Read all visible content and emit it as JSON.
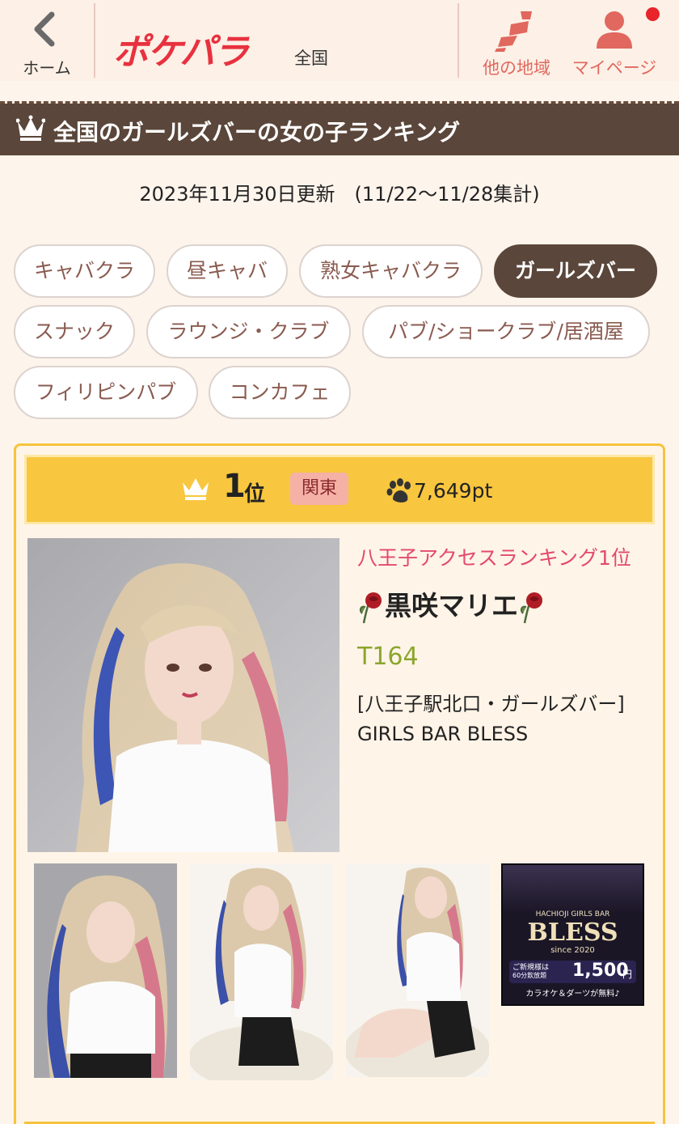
{
  "header": {
    "back_label": "ホーム",
    "logo_text": "ポケパラ",
    "logo_sub": "全国",
    "region_label": "他の地域",
    "mypage_label": "マイページ"
  },
  "title": "全国のガールズバーの女の子ランキング",
  "update_text": "2023年11月30日更新　(11/22〜11/28集計)",
  "categories": [
    {
      "label": "キャバクラ",
      "active": false
    },
    {
      "label": "昼キャバ",
      "active": false
    },
    {
      "label": "熟女キャバクラ",
      "active": false
    },
    {
      "label": "ガールズバー",
      "active": true
    },
    {
      "label": "スナック",
      "active": false
    },
    {
      "label": "ラウンジ・クラブ",
      "active": false
    },
    {
      "label": "パブ/ショークラブ/居酒屋",
      "active": false
    },
    {
      "label": "フィリピンパブ",
      "active": false
    },
    {
      "label": "コンカフェ",
      "active": false
    }
  ],
  "ranking": {
    "rank_number": "1",
    "rank_suffix": "位",
    "area": "関東",
    "points": "7,649pt",
    "access_rank": "八王子アクセスランキング1位",
    "name": "黒咲マリエ",
    "height": "T164",
    "shop_location": "[八王子駅北口・ガールズバー]",
    "shop_name": "GIRLS BAR BLESS"
  },
  "shop_banner": {
    "area_text": "HACHIOJI GIRLS BAR",
    "brand": "BLESS",
    "since": "since 2020",
    "promo_prefix": "ご新規様は",
    "promo_time": "60分飲放題",
    "promo_price": "1,500",
    "promo_unit": "円",
    "promo_note": "カラオケ＆ダーツが無料♪"
  },
  "colors": {
    "header_bg": "#fdf0e6",
    "title_bg": "#5a463a",
    "accent_red": "#e8313f",
    "rank_yellow": "#f8c63f",
    "area_badge": "#f6b1a6",
    "access_pink": "#e24a6c",
    "height_green": "#8aa62c"
  },
  "icons": [
    "chevron-left-icon",
    "japan-map-icon",
    "user-icon",
    "crown-icon",
    "paw-icon",
    "rose-icon"
  ]
}
